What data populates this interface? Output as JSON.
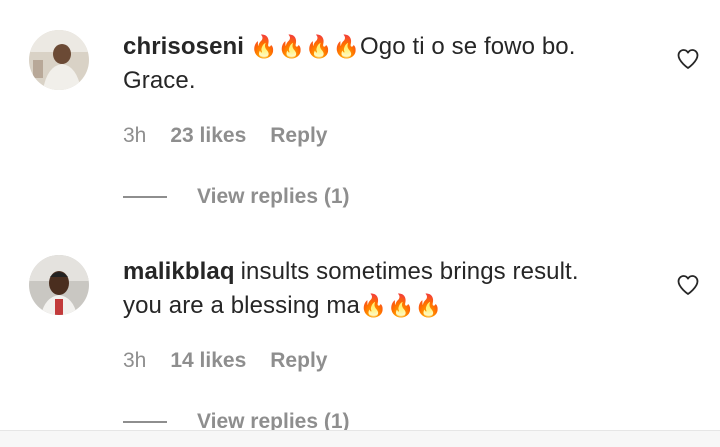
{
  "comments": [
    {
      "username": "chrisoseni",
      "text_after_emoji": "Ogo ti o se fowo bo.",
      "text_line2": "Grace.",
      "emoji": "🔥🔥🔥🔥",
      "time": "3h",
      "likes": "23 likes",
      "reply_label": "Reply",
      "view_replies": "View replies (1)"
    },
    {
      "username": "malikblaq",
      "text_line1": "insults sometimes brings result.",
      "text_line2": "you are a blessing ma",
      "emoji": "🔥🔥🔥",
      "time": "3h",
      "likes": "14 likes",
      "reply_label": "Reply",
      "view_replies": "View replies (1)"
    }
  ],
  "icons": {
    "like": "heart-outline-icon",
    "fire": "fire-emoji"
  },
  "colors": {
    "text": "#262626",
    "secondary": "#8e8e8e",
    "fire_orange": "#f4900c"
  }
}
